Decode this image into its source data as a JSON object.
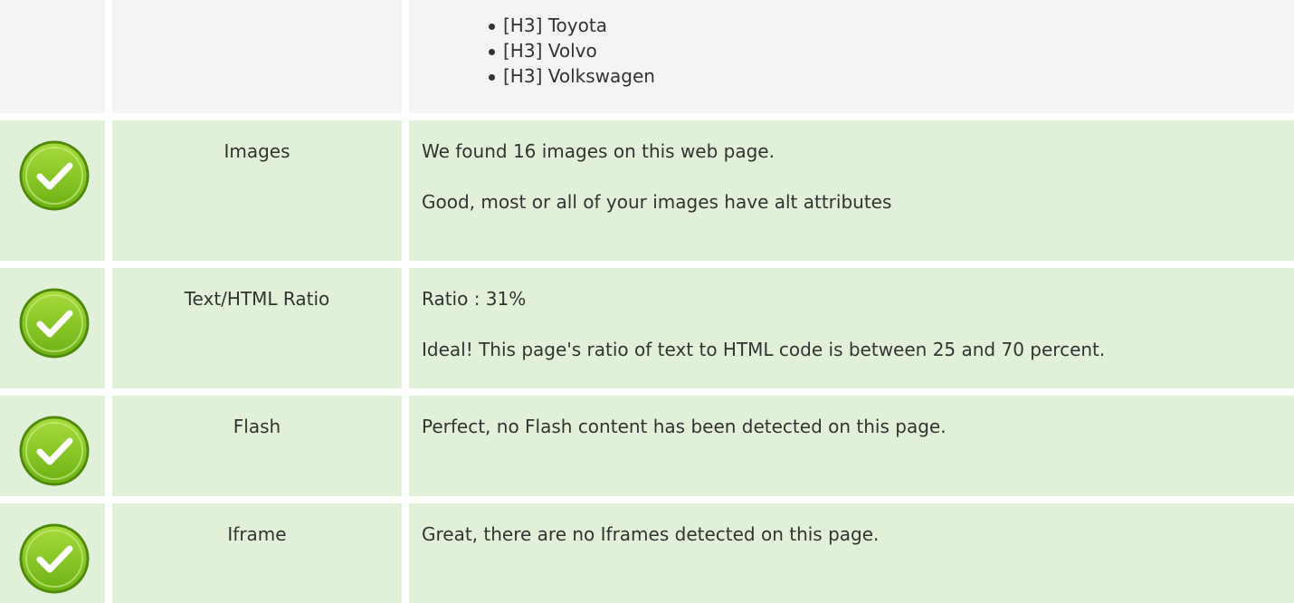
{
  "headings_list": {
    "items": [
      "[H3] Toyota",
      "[H3] Volvo",
      "[H3] Volkswagen"
    ]
  },
  "checks": [
    {
      "status": "pass",
      "icon": "check-circle-icon",
      "label": "Images",
      "lines": [
        "We found 16 images on this web page.",
        "Good, most or all of your images have alt attributes"
      ]
    },
    {
      "status": "pass",
      "icon": "check-circle-icon",
      "label": "Text/HTML Ratio",
      "lines": [
        "Ratio : 31%",
        "Ideal! This page's ratio of text to HTML code is between 25 and 70 percent."
      ]
    },
    {
      "status": "pass",
      "icon": "check-circle-icon",
      "label": "Flash",
      "lines": [
        "Perfect, no Flash content has been detected on this page."
      ]
    },
    {
      "status": "pass",
      "icon": "check-circle-icon",
      "label": "Iframe",
      "lines": [
        "Great, there are no Iframes detected on this page."
      ]
    }
  ],
  "colors": {
    "pass_row_bg": "#e1f0d8",
    "neutral_row_bg": "#f4f4f4",
    "check_green": "#7ec320",
    "check_border": "#4f8a0b"
  }
}
